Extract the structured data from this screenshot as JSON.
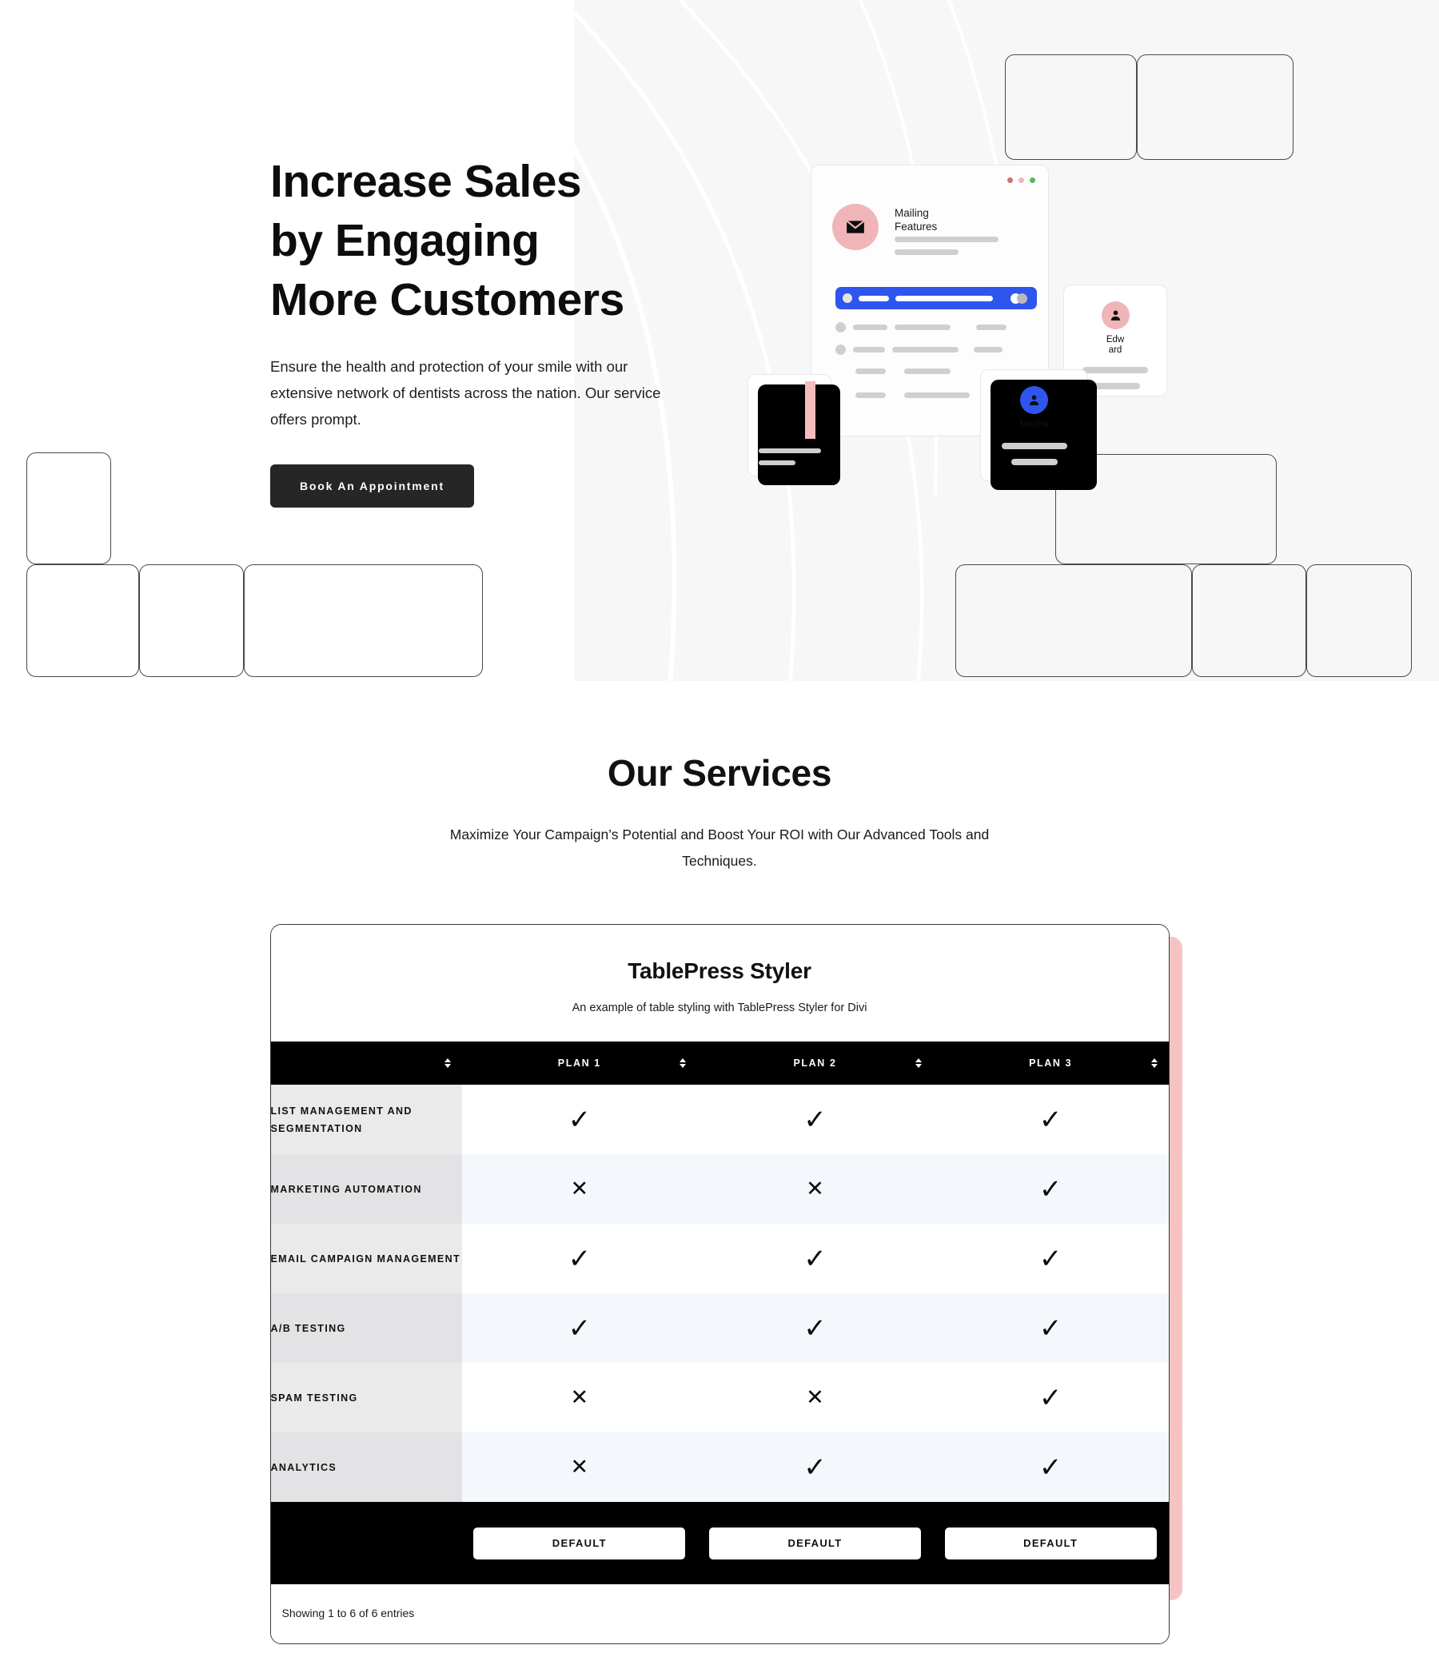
{
  "hero": {
    "title": "Increase Sales\nby Engaging\nMore Customers",
    "subtitle": "Ensure the health and protection of your smile with our extensive network of dentists across the nation. Our service offers prompt.",
    "cta_label": "Book An Appointment",
    "illustration": {
      "mail_card": {
        "title": "Mailing Features",
        "icon": "envelope-icon",
        "dot_colors": [
          "#d4706c",
          "#f0b5b8",
          "#58b85a"
        ],
        "accent_color": "#2f55ef",
        "avatar_color": "#f0b5b8"
      },
      "chart_card": {
        "icon": "bar-chart-icon",
        "bar_colors": [
          "#000000",
          "#000000",
          "#000000",
          "#f4bcbc"
        ]
      },
      "edward_card": {
        "name": "Edw ard",
        "icon": "person-icon",
        "avatar_color": "#f0b5b8"
      },
      "martha_card": {
        "name": "Martha",
        "icon": "person-icon",
        "avatar_color": "#2f55ef"
      }
    }
  },
  "services": {
    "title": "Our Services",
    "subtitle": "Maximize Your Campaign’s Potential and Boost Your ROI with Our Advanced Tools and Techniques."
  },
  "table": {
    "title": "TablePress Styler",
    "description": "An example of table styling with TablePress Styler for Divi",
    "columns": [
      "",
      "PLAN 1",
      "PLAN 2",
      "PLAN 3"
    ],
    "rows": [
      {
        "label": "LIST MANAGEMENT AND SEGMENTATION",
        "values": [
          "check",
          "check",
          "check"
        ]
      },
      {
        "label": "MARKETING AUTOMATION",
        "values": [
          "cross",
          "cross",
          "check"
        ]
      },
      {
        "label": "EMAIL CAMPAIGN MANAGEMENT",
        "values": [
          "check",
          "check",
          "check"
        ]
      },
      {
        "label": "A/B TESTING",
        "values": [
          "check",
          "check",
          "check"
        ]
      },
      {
        "label": "SPAM TESTING",
        "values": [
          "cross",
          "cross",
          "check"
        ]
      },
      {
        "label": "ANALYTICS",
        "values": [
          "cross",
          "check",
          "check"
        ]
      }
    ],
    "footer_buttons": [
      "DEFAULT",
      "DEFAULT",
      "DEFAULT"
    ],
    "info": "Showing 1 to 6 of 6 entries",
    "glyphs": {
      "check": "✓",
      "cross": "✕"
    },
    "colors": {
      "header_bg": "#000000",
      "shadow": "#f6c3c3",
      "row_alt": "#f4f8fc",
      "label_bg": "#eaeaea"
    }
  }
}
